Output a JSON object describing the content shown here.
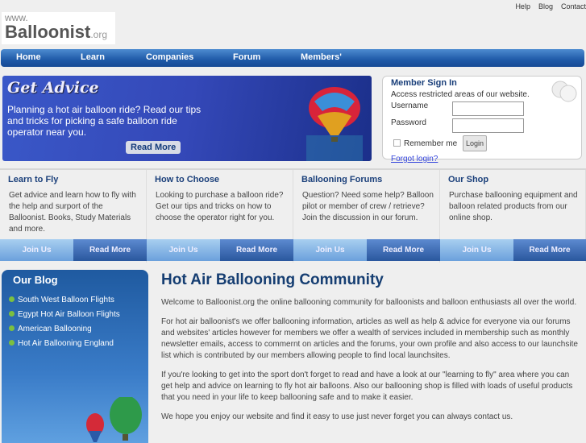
{
  "top_links": [
    "Help",
    "Blog",
    "Contact"
  ],
  "logo": {
    "www": "www.",
    "name": "Balloonist",
    "tld": ".org"
  },
  "nav": [
    "Home",
    "Learn",
    "Companies",
    "Forum",
    "Members'"
  ],
  "banner": {
    "title": "Get Advice",
    "text": "Planning a hot air balloon ride? Read our tips and tricks for picking a safe balloon ride operator near you.",
    "button": "Read More"
  },
  "signin": {
    "title": "Member Sign In",
    "subtitle": "Access restricted areas of our website.",
    "username_label": "Username",
    "password_label": "Password",
    "remember": "Remember me",
    "login": "Login",
    "forgot": "Forgot login?"
  },
  "features": [
    {
      "title": "Learn to Fly",
      "text": "Get advice and learn how to fly with the help and surport of the Balloonist. Books, Study Materials and more.",
      "join": "Join Us",
      "more": "Read More"
    },
    {
      "title": "How to Choose",
      "text": "Looking to purchase a balloon ride? Get our tips and tricks on how to choose the operator right for you.",
      "join": "Join Us",
      "more": "Read More"
    },
    {
      "title": "Ballooning Forums",
      "text": "Question? Need some help? Balloon pilot or member of crew / retrieve? Join the discussion in our forum.",
      "join": "Join Us",
      "more": "Read More"
    },
    {
      "title": "Our Shop",
      "text": "Purchase ballooning equipment and balloon related products from our online shop.",
      "join": "Join Us",
      "more": "Read More"
    }
  ],
  "blog": {
    "title": "Our Blog",
    "items": [
      "South West Balloon Flights",
      "Egypt Hot Air Balloon Flights",
      "American Ballooning",
      "Hot Air Ballooning England"
    ]
  },
  "main": {
    "title": "Hot Air Ballooning Community",
    "paragraphs": [
      "Welcome to Balloonist.org the online ballooning community for balloonists and balloon enthusiasts all over the world.",
      "For hot air balloonist's we offer ballooning information, articles as well as help & advice for everyone via our forums and websites' articles however for members we offer a wealth of services included in membership such as monthly newsletter emails, access to commernt on articles and the forums, your own profile and also access to our launchsite list which is contributed by our members allowing people to find local launchsites.",
      "If you're looking to get into the sport don't forget to read and have a look at our \"learning to fly\" area where you can get help and advice on learning to fly hot air balloons. Also our ballooning shop is filled with loads of useful products that you need in your life to keep ballooning safe and to make it easier.",
      "We hope you enjoy our website and find it easy to use just never forget you can always contact us."
    ]
  }
}
